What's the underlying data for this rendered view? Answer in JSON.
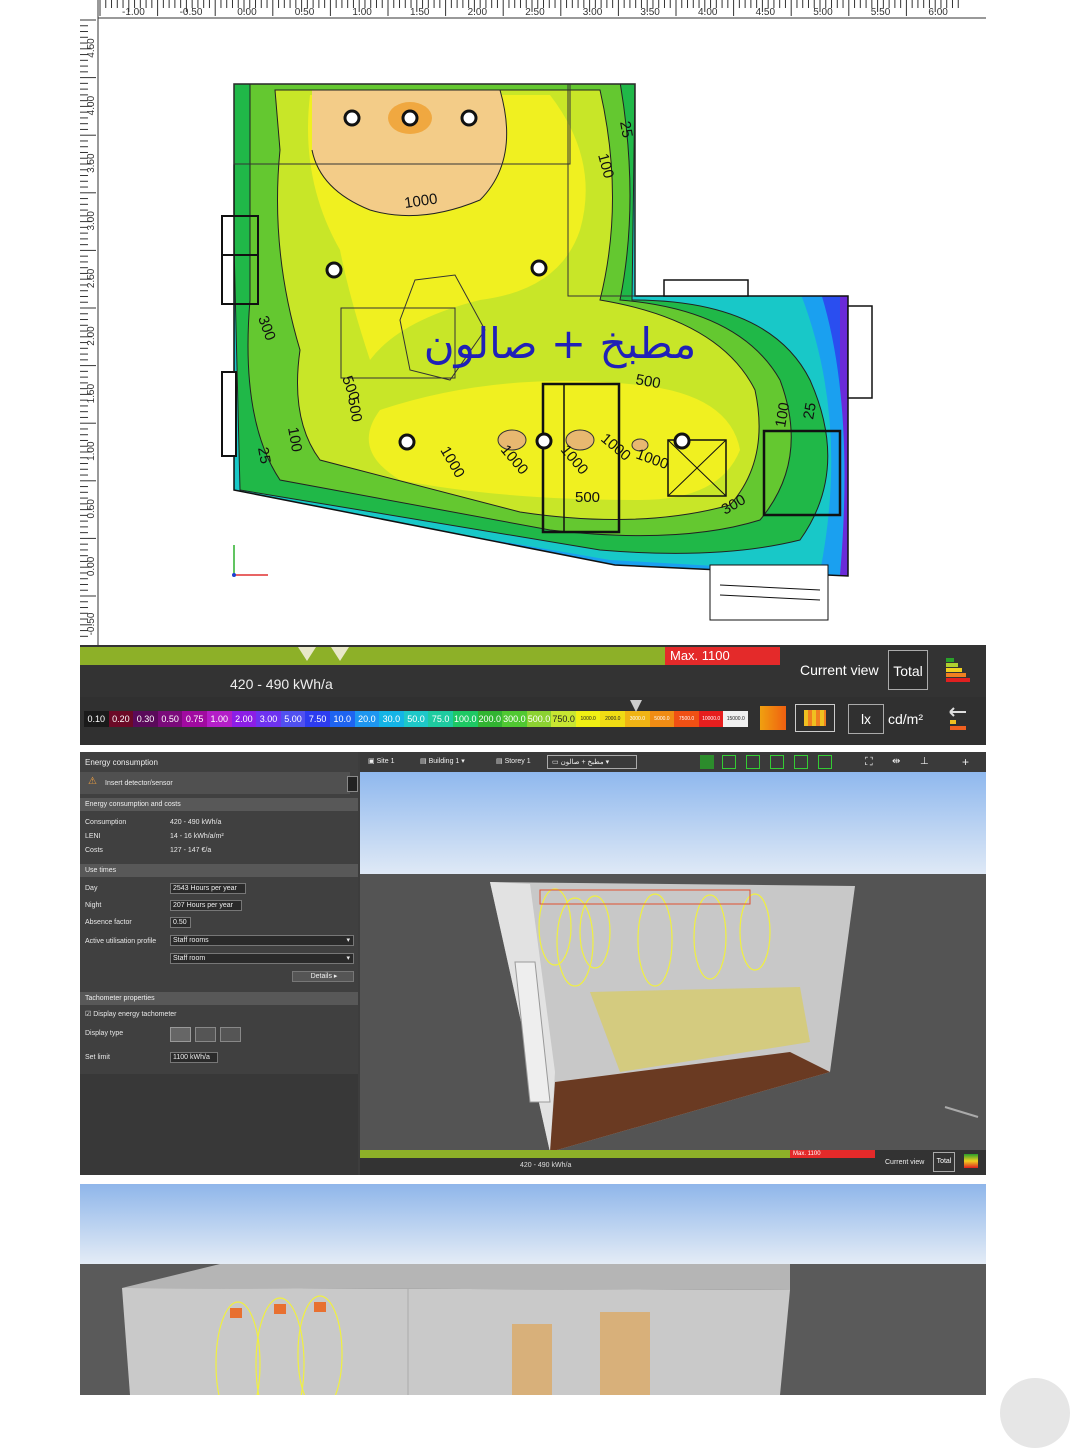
{
  "plan": {
    "ruler_top_labels": [
      "-1.00",
      "-0.50",
      "0.00",
      "0.50",
      "1.00",
      "1.50",
      "2.00",
      "2.50",
      "3.00",
      "3.50",
      "4.00",
      "4.50",
      "5.00",
      "5.50",
      "6.00"
    ],
    "ruler_left_labels": [
      "4.50",
      "4.00",
      "3.50",
      "3.00",
      "2.50",
      "2.00",
      "1.50",
      "1.00",
      "0.50",
      "0.00",
      "-0.50"
    ],
    "room_label": "مطبخ + صالون",
    "contour_labels": [
      "1000",
      "300",
      "100",
      "25",
      "500",
      "500",
      "100",
      "25",
      "500",
      "1000",
      "300",
      "500",
      "100",
      "25",
      "1000",
      "1000",
      "1000",
      "1000"
    ],
    "tacho": {
      "max_label": "Max. 1100",
      "range_label": "420 - 490 kWh/a",
      "current_view_label": "Current view",
      "total_label": "Total"
    },
    "legend": {
      "values": [
        "0.10",
        "0.20",
        "0.30",
        "0.50",
        "0.75",
        "1.00",
        "2.00",
        "3.00",
        "5.00",
        "7.50",
        "10.0",
        "20.0",
        "30.0",
        "50.0",
        "75.0",
        "100.0",
        "200.0",
        "300.0",
        "500.0",
        "750.0",
        "1000.0",
        "2000.0",
        "3000.0",
        "5000.0",
        "7500.0",
        "10000.0",
        "15000.0"
      ],
      "colors": [
        "#1a1a1a",
        "#6b0a26",
        "#5a0a5a",
        "#7a0a7a",
        "#a00aa0",
        "#b41ec8",
        "#8c1ee6",
        "#6e32f0",
        "#5050f0",
        "#2d3cf0",
        "#1e64f0",
        "#1e96f0",
        "#14b4e6",
        "#1ec8c8",
        "#1ecba0",
        "#1ec864",
        "#32b432",
        "#50c832",
        "#8cd232",
        "#c8e632",
        "#f0f014",
        "#f0dc14",
        "#f0b414",
        "#f08c14",
        "#f05014",
        "#e61e1e",
        "#f0f0f0"
      ],
      "unit_lx": "lx",
      "unit_cdm": "cd/m²"
    }
  },
  "panel": {
    "title": "Energy consumption",
    "insert_label": "Insert detector/sensor",
    "section_costs": "Energy consumption and costs",
    "consumption_label": "Consumption",
    "consumption_value": "420 - 490 kWh/a",
    "leni_label": "LENI",
    "leni_value": "14 - 16 kWh/a/m²",
    "costs_label": "Costs",
    "costs_value": "127 - 147 €/a",
    "section_use": "Use times",
    "day_label": "Day",
    "day_value": "2543",
    "day_unit": "Hours per year",
    "night_label": "Night",
    "night_value": "207",
    "night_unit": "Hours per year",
    "absence_label": "Absence factor",
    "absence_value": "0.50",
    "profile_label": "Active utilisation profile",
    "profile_value": "Staff rooms",
    "profile_sub_value": "Staff room",
    "details_label": "Details",
    "section_tacho": "Tachometer properties",
    "display_tacho_label": "Display energy tachometer",
    "display_type_label": "Display type",
    "set_limit_label": "Set limit",
    "set_limit_value": "1100",
    "set_limit_unit": "kWh/a"
  },
  "viewport_toolbar": {
    "site": "Site 1",
    "building": "Building 1",
    "storey": "Storey 1",
    "room": "مطبخ + صالون"
  },
  "mini_tacho": {
    "max_label": "Max. 1100",
    "range_label": "420 - 490 kWh/a",
    "current_view_label": "Current view",
    "total_label": "Total"
  }
}
